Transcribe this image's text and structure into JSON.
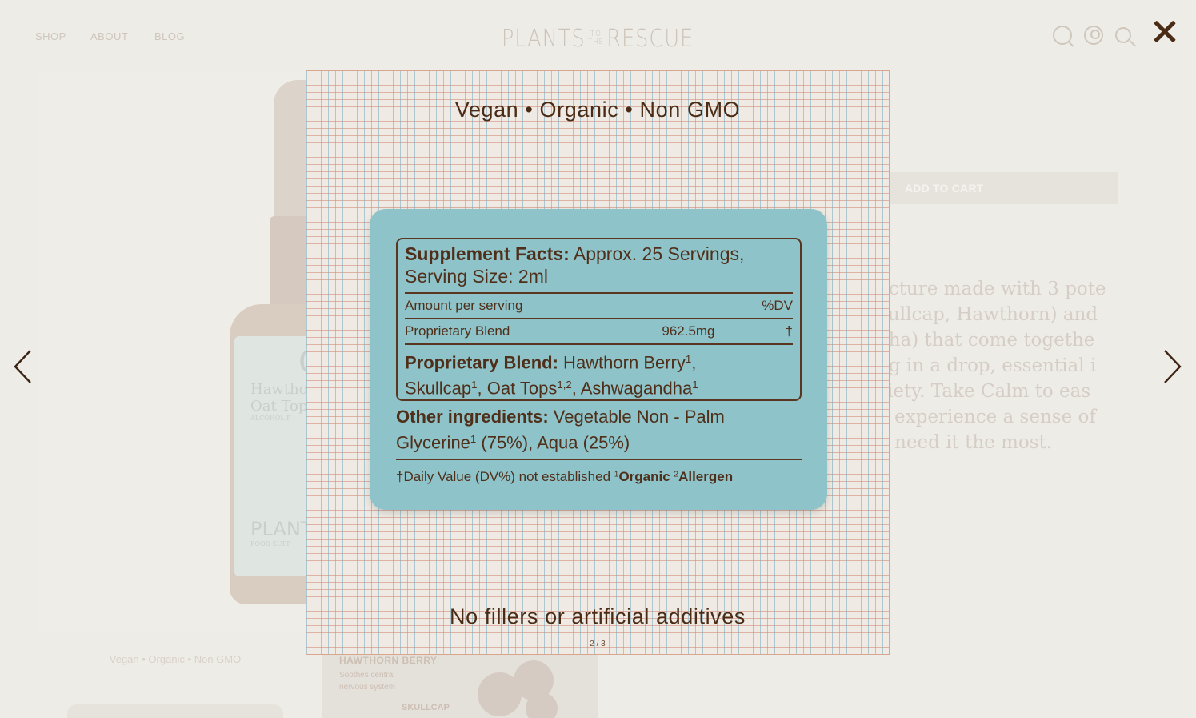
{
  "nav": {
    "links": [
      "SHOP",
      "ABOUT",
      "BLOG"
    ],
    "logo_left": "PLANTS",
    "logo_small_top": "TO",
    "logo_small_bottom": "THE",
    "logo_right": "RESCUE",
    "icons": [
      "quiz-icon",
      "account-icon",
      "search-icon",
      "cart-icon"
    ]
  },
  "background": {
    "bottle_label_big": "CA",
    "bottle_label_line1": "Hawtho",
    "bottle_label_line2": "Oat Tops,",
    "bottle_label_small": "ALCOHOL F",
    "bottle_label_brand": "PLANTS",
    "bottle_label_brand_sub": "FOOD SUPP",
    "caption": "Vegan • Organic • Non GMO",
    "tile_title": "HAWTHORN BERRY",
    "tile_desc_1": "Soothes central",
    "tile_desc_2": "nervous system",
    "tile_next": "SKULLCAP",
    "add_to_cart": "ADD TO CART",
    "description_lines": [
      "ncture made with 3 pote",
      "kullcap,  Hawthorn) and",
      "dha) that come togethe",
      "ug in a drop,  essential i",
      "xiety. Take Calm to eas",
      "d experience a sense of",
      "u need it the most."
    ]
  },
  "lightbox": {
    "counter": "2 / 3",
    "heading": "Vegan • Organic • Non GMO",
    "footer": "No fillers or artificial additives",
    "facts": {
      "title_bold": "Supplement Facts:",
      "title_rest": " Approx. 25 Servings,",
      "serving_size": "Serving Size: 2ml",
      "amount_label": "Amount per serving",
      "dv_label": "%DV",
      "blend_label": "Proprietary Blend",
      "blend_amount": "962.5mg",
      "blend_dv": "†",
      "blend_title": "Proprietary Blend:",
      "blend_items_line1": " Hawthorn Berry",
      "blend_items_line2a": "Skullcap",
      "blend_items_line2b": ", Oat Tops",
      "blend_items_line2c": ", Ashwagandha",
      "other_title": "Other ingredients:",
      "other_line1": " Vegetable Non - Palm",
      "other_line2a": "Glycerine",
      "other_line2b": "  (75%), Aqua (25%)",
      "dv_note_a": "†Daily Value (DV%) not established ",
      "dv_note_b": "Organic ",
      "dv_note_c": "Allergen",
      "sup1": "1",
      "sup12": "1,2",
      "sup2": "2"
    }
  },
  "colors": {
    "page_bg": "#eeece7",
    "card_teal": "#8ec3c9",
    "brown_text": "#4a2c16"
  }
}
